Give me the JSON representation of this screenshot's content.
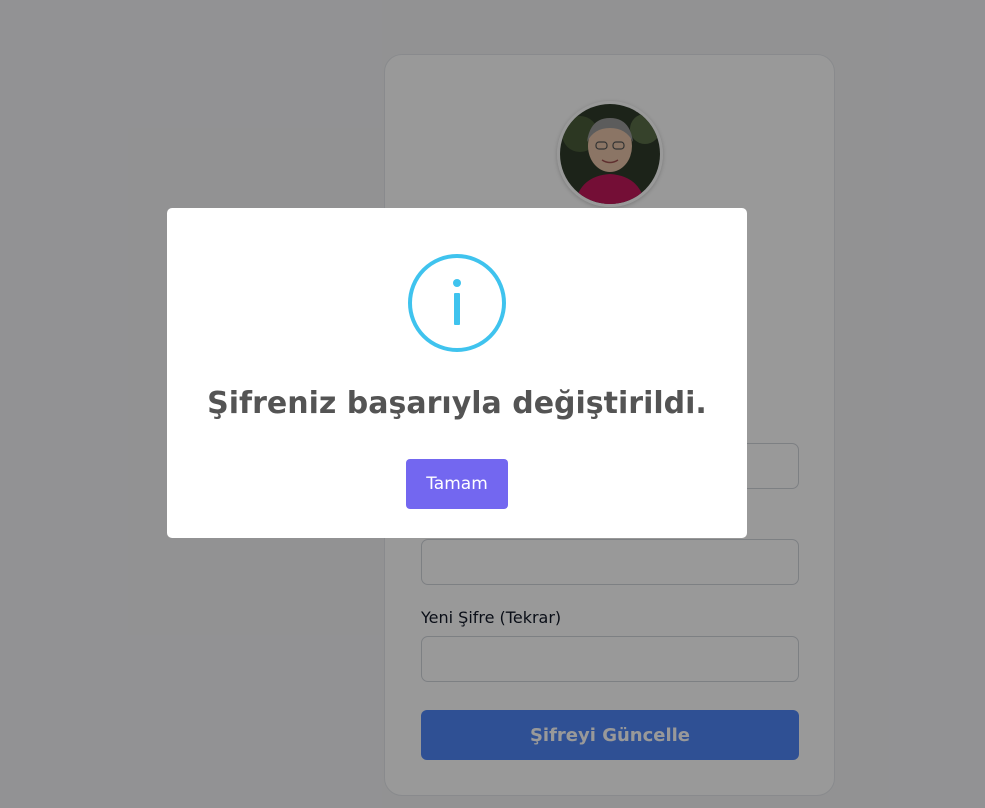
{
  "form": {
    "confirm_password_label": "Yeni Şifre (Tekrar)",
    "submit_label": "Şifreyi Güncelle"
  },
  "dialog": {
    "icon": "info-icon",
    "message": "Şifreniz başarıyla değiştirildi.",
    "confirm_label": "Tamam",
    "icon_color": "#3fc3ee",
    "confirm_color": "#7367f0"
  }
}
